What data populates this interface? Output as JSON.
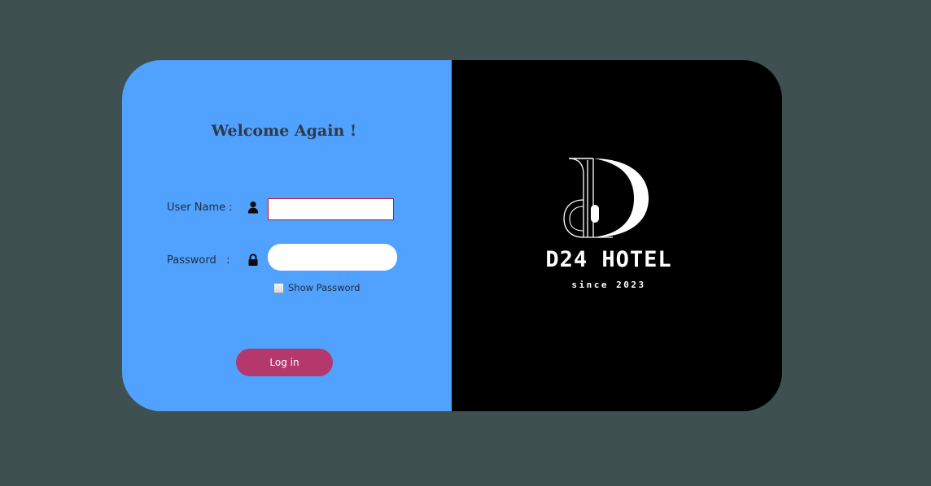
{
  "login": {
    "title": "Welcome Again !",
    "username_label": "User Name :",
    "username_value": "",
    "password_label": "Password   :",
    "password_value": "",
    "show_password_label": "Show Password",
    "show_password_checked": false,
    "login_button": "Log in",
    "icons": {
      "username": "user-icon",
      "password": "lock-icon"
    }
  },
  "brand": {
    "name": "D24 HOTEL",
    "tagline": "since 2023"
  },
  "colors": {
    "background": "#3f5050",
    "form_panel": "#51a1ff",
    "brand_panel": "#000000",
    "login_button": "#b5386d",
    "focused_input_border": "#c8102e"
  }
}
